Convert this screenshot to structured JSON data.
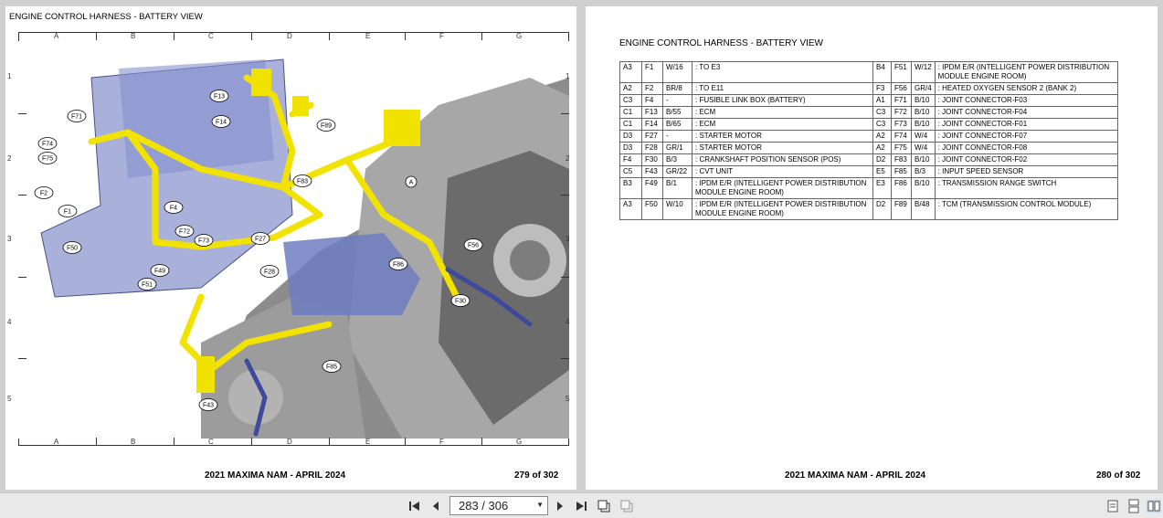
{
  "left_page": {
    "title": "ENGINE CONTROL HARNESS - BATTERY VIEW",
    "footer_left": "2021 MAXIMA NAM - APRIL 2024",
    "footer_right": "279 of 302",
    "grid_columns": [
      "A",
      "B",
      "C",
      "D",
      "E",
      "F",
      "G"
    ],
    "grid_rows": [
      "1",
      "2",
      "3",
      "4",
      "5"
    ],
    "connector_labels": [
      "F13",
      "F14",
      "F89",
      "F71",
      "F74",
      "F75",
      "F83",
      "F2",
      "F4",
      "F1",
      "F72",
      "F73",
      "F27",
      "F56",
      "F50",
      "F49",
      "F51",
      "F28",
      "F86",
      "F30",
      "F85",
      "F43",
      "A"
    ]
  },
  "right_page": {
    "title": "ENGINE CONTROL HARNESS - BATTERY VIEW",
    "footer_left": "2021 MAXIMA NAM - APRIL 2024",
    "footer_right": "280 of 302",
    "table": [
      [
        "A3",
        "F1",
        "W/16",
        ": TO E3",
        "B4",
        "F51",
        "W/12",
        ": IPDM E/R (INTELLIGENT POWER DISTRIBUTION MODULE ENGINE ROOM)"
      ],
      [
        "A2",
        "F2",
        "BR/8",
        ": TO E11",
        "F3",
        "F56",
        "GR/4",
        ": HEATED OXYGEN SENSOR 2 (BANK 2)"
      ],
      [
        "C3",
        "F4",
        "-",
        ": FUSIBLE LINK BOX (BATTERY)",
        "A1",
        "F71",
        "B/10",
        ": JOINT CONNECTOR-F03"
      ],
      [
        "C1",
        "F13",
        "B/55",
        ": ECM",
        "C3",
        "F72",
        "B/10",
        ": JOINT CONNECTOR-F04"
      ],
      [
        "C1",
        "F14",
        "B/65",
        ": ECM",
        "C3",
        "F73",
        "B/10",
        ": JOINT CONNECTOR-F01"
      ],
      [
        "D3",
        "F27",
        "-",
        ": STARTER MOTOR",
        "A2",
        "F74",
        "W/4",
        ": JOINT CONNECTOR-F07"
      ],
      [
        "D3",
        "F28",
        "GR/1",
        ": STARTER MOTOR",
        "A2",
        "F75",
        "W/4",
        ": JOINT CONNECTOR-F08"
      ],
      [
        "F4",
        "F30",
        "B/3",
        ": CRANKSHAFT POSITION SENSOR (POS)",
        "D2",
        "F83",
        "B/10",
        ": JOINT CONNECTOR-F02"
      ],
      [
        "C5",
        "F43",
        "GR/22",
        ": CVT UNIT",
        "E5",
        "F85",
        "B/3",
        ": INPUT SPEED SENSOR"
      ],
      [
        "B3",
        "F49",
        "B/1",
        ": IPDM E/R (INTELLIGENT POWER DISTRIBUTION MODULE ENGINE ROOM)",
        "E3",
        "F86",
        "B/10",
        ": TRANSMISSION RANGE SWITCH"
      ],
      [
        "A3",
        "F50",
        "W/10",
        ": IPDM E/R (INTELLIGENT POWER DISTRIBUTION MODULE ENGINE ROOM)",
        "D2",
        "F89",
        "B/48",
        ": TCM (TRANSMISSION CONTROL MODULE)"
      ]
    ]
  },
  "toolbar": {
    "page_indicator": "283 / 306",
    "icons": [
      "first-page-icon",
      "prev-page-icon",
      "next-page-icon",
      "last-page-icon",
      "rotate-icon",
      "duplicate-icon",
      "single-page-icon",
      "continuous-icon",
      "two-page-icon"
    ]
  },
  "colors": {
    "harness": "#f2e200",
    "battery": "#6f7cc0",
    "background": "#d0d0d0"
  }
}
